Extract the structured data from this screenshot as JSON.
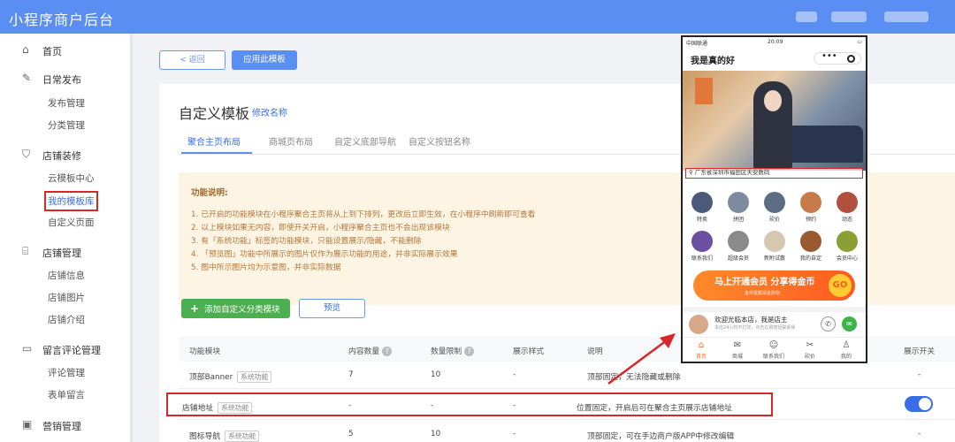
{
  "header": {
    "app_title": "小程序商户后台"
  },
  "sidebar": {
    "groups": [
      {
        "label": "首页",
        "icon": "home-icon"
      },
      {
        "label": "日常发布",
        "icon": "edit-icon",
        "items": [
          "发布管理",
          "分类管理"
        ]
      },
      {
        "label": "店铺装修",
        "icon": "brush-icon",
        "items": [
          "云模板中心",
          "我的模板库",
          "自定义页面"
        ]
      },
      {
        "label": "店铺管理",
        "icon": "store-icon",
        "items": [
          "店铺信息",
          "店铺图片",
          "店铺介绍"
        ]
      },
      {
        "label": "留言评论管理",
        "icon": "comment-icon",
        "items": [
          "评论管理",
          "表单留言"
        ]
      },
      {
        "label": "营销管理",
        "icon": "marketing-icon"
      }
    ],
    "active_item": "我的模板库"
  },
  "toolbar": {
    "back_label": "< 返回",
    "apply_label": "应用此模板"
  },
  "page": {
    "title": "自定义模板",
    "rename_link": "修改名称",
    "tabs": [
      "聚合主页布局",
      "商城页布局",
      "自定义底部导航",
      "自定义按钮名称"
    ],
    "active_tab": 0
  },
  "notice": {
    "title": "功能说明:",
    "lines": [
      "1. 已开启的功能模块在小程序聚合主页将从上到下排列，更改后立即生效，在小程序中刷新即可查看",
      "2. 以上模块如果无内容，即使开关开启，小程序聚合主页也不会出现该模块",
      "3. 有「系统功能」标签的功能模块，只能设置展示/隐藏，不能删除",
      "4. 「预览图」功能中所展示的图片仅作为展示功能的用途，并非实际展示效果",
      "5. 图中所示图片均为示意图，并非实际数据"
    ]
  },
  "actions": {
    "add_label": "添加自定义分类模块",
    "preview_label": "预览"
  },
  "table": {
    "headers": [
      "功能模块",
      "内容数量",
      "数量限制",
      "展示样式",
      "说明",
      "展示开关"
    ],
    "rows": [
      {
        "name": "顶部Banner",
        "badge": "系统功能",
        "count": "7",
        "limit": "10",
        "style": "-",
        "desc": "顶部固定，无法隐藏或删除",
        "switch": "-"
      },
      {
        "name": "店铺地址",
        "badge": "系统功能",
        "count": "-",
        "limit": "-",
        "style": "-",
        "desc": "位置固定，开启后可在聚合主页展示店铺地址",
        "switch": "on"
      },
      {
        "name": "图标导航",
        "badge": "系统功能",
        "count": "5",
        "limit": "10",
        "style": "-",
        "desc": "顶部固定，可在手边商户版APP中修改编辑",
        "switch": "-"
      }
    ]
  },
  "phone": {
    "status_left": "中国联通",
    "status_time": "20:09",
    "status_right": "▭",
    "title": "我是真的好",
    "capsule_dots": "•••",
    "address": "广东省深圳市福田区天安数码",
    "grid": [
      {
        "label": "特卖",
        "color": "#4a5a78"
      },
      {
        "label": "拼团",
        "color": "#7d8aa0"
      },
      {
        "label": "砍价",
        "color": "#5d6d84"
      },
      {
        "label": "预约",
        "color": "#c77a4a"
      },
      {
        "label": "动态",
        "color": "#b2503f"
      },
      {
        "label": "联系我们",
        "color": "#6b4fa0"
      },
      {
        "label": "超级会员",
        "color": "#8a8a8a"
      },
      {
        "label": "新附试散",
        "color": "#d8c7b0"
      },
      {
        "label": "我的自定",
        "color": "#9a5a30"
      },
      {
        "label": "会员中心",
        "color": "#8aa034"
      }
    ],
    "vip_title": "马上开通会员 分享得金币",
    "vip_sub": "金币抵额现金购物",
    "vip_go": "GO",
    "welcome_title": "欢迎光临本店，我是店主",
    "welcome_sub": "本店24小时不打烊，点击右侧按钮联系我",
    "tabbar": [
      {
        "label": "首页",
        "icon": "⌂"
      },
      {
        "label": "商城",
        "icon": "✉"
      },
      {
        "label": "联系我们",
        "icon": "☺"
      },
      {
        "label": "砍价",
        "icon": "✂"
      },
      {
        "label": "我的",
        "icon": "♙"
      }
    ]
  },
  "colors": {
    "brand": "#5b8ef2",
    "highlight": "#d9262b",
    "success": "#4caf50"
  }
}
